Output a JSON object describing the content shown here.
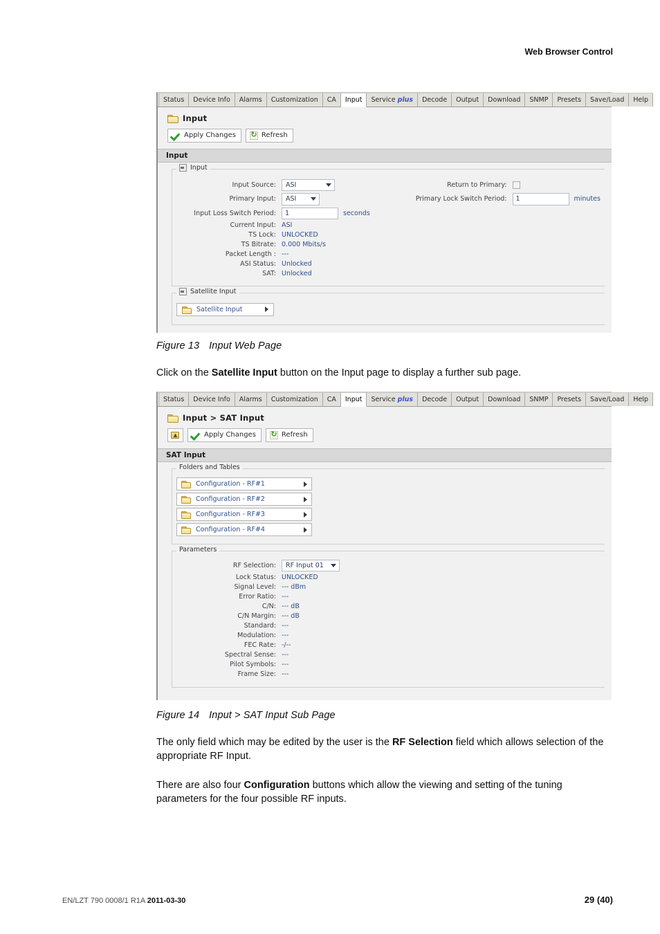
{
  "header": {
    "title": "Web Browser Control"
  },
  "footer": {
    "doc_id": "EN/LZT 790 0008/1 R1A",
    "doc_date": "2011-03-30",
    "page_number": "29 (40)"
  },
  "tabs": [
    {
      "label": "Status",
      "active": false
    },
    {
      "label": "Device Info",
      "active": false
    },
    {
      "label": "Alarms",
      "active": false
    },
    {
      "label": "Customization",
      "active": false
    },
    {
      "label": "CA",
      "active": false
    },
    {
      "label": "Input",
      "active": true
    },
    {
      "label": "Service",
      "suffix": "plus",
      "active": false
    },
    {
      "label": "Decode",
      "active": false
    },
    {
      "label": "Output",
      "active": false
    },
    {
      "label": "Download",
      "active": false
    },
    {
      "label": "SNMP",
      "active": false
    },
    {
      "label": "Presets",
      "active": false
    },
    {
      "label": "Save/Load",
      "active": false
    },
    {
      "label": "Help",
      "active": false
    }
  ],
  "figure13": {
    "page_title": "Input",
    "toolbar": {
      "apply_label": "Apply Changes",
      "refresh_label": "Refresh"
    },
    "section_title": "Input",
    "input_group": {
      "legend": "Input",
      "input_source_label": "Input Source:",
      "input_source_value": "ASI",
      "primary_input_label": "Primary Input:",
      "primary_input_value": "ASI",
      "input_loss_switch_period_label": "Input Loss Switch Period:",
      "input_loss_switch_period_value": "1",
      "input_loss_switch_period_unit": "seconds",
      "return_to_primary_label": "Return to Primary:",
      "primary_lock_switch_period_label": "Primary Lock Switch Period:",
      "primary_lock_switch_period_value": "1",
      "primary_lock_switch_period_unit": "minutes",
      "status_rows": [
        {
          "label": "Current Input:",
          "value": "ASI"
        },
        {
          "label": "TS Lock:",
          "value": "UNLOCKED"
        },
        {
          "label": "TS Bitrate:",
          "value": "0.000 Mbits/s"
        },
        {
          "label": "Packet Length :",
          "value": "---"
        },
        {
          "label": "ASI Status:",
          "value": "Unlocked"
        },
        {
          "label": "SAT:",
          "value": "Unlocked"
        }
      ]
    },
    "satellite_group": {
      "legend": "Satellite Input",
      "button_label": "Satellite Input"
    },
    "caption_num": "Figure 13",
    "caption_text": "Input Web Page"
  },
  "between_text": {
    "prefix": "Click on the ",
    "bold": "Satellite Input",
    "suffix": " button on the Input page to display a further sub page."
  },
  "figure14": {
    "page_title": "Input > SAT Input",
    "toolbar": {
      "up_label": "",
      "apply_label": "Apply Changes",
      "refresh_label": "Refresh"
    },
    "section_title": "SAT Input",
    "folders_group": {
      "legend": "Folders and Tables",
      "buttons": [
        {
          "label": "Configuration - RF#1"
        },
        {
          "label": "Configuration - RF#2"
        },
        {
          "label": "Configuration - RF#3"
        },
        {
          "label": "Configuration - RF#4"
        }
      ]
    },
    "parameters_group": {
      "legend": "Parameters",
      "rf_selection_label": "RF Selection:",
      "rf_selection_value": "RF Input 01",
      "rows": [
        {
          "label": "Lock Status:",
          "value": "UNLOCKED"
        },
        {
          "label": "Signal Level:",
          "value": "--- dBm"
        },
        {
          "label": "Error Ratio:",
          "value": "---"
        },
        {
          "label": "C/N:",
          "value": "--- dB"
        },
        {
          "label": "C/N Margin:",
          "value": "--- dB"
        },
        {
          "label": "Standard:",
          "value": "---"
        },
        {
          "label": "Modulation:",
          "value": "---"
        },
        {
          "label": "FEC Rate:",
          "value": "-/--"
        },
        {
          "label": "Spectral Sense:",
          "value": "---"
        },
        {
          "label": "Pilot Symbols:",
          "value": "---"
        },
        {
          "label": "Frame Size:",
          "value": "---"
        }
      ]
    },
    "caption_num": "Figure 14",
    "caption_text": "Input > SAT Input Sub Page"
  },
  "paragraphs": [
    {
      "prefix": "The only field which may be edited by the user is the ",
      "bold": "RF Selection",
      "suffix": " field which allows selection of the appropriate RF Input."
    },
    {
      "prefix": "There are also four ",
      "bold": "Configuration",
      "suffix": " buttons which allow the viewing and setting of the tuning parameters for the four possible RF inputs."
    }
  ]
}
